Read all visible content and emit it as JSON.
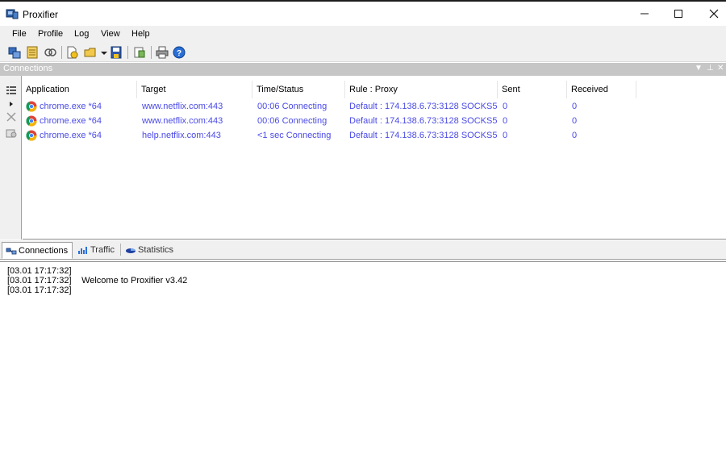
{
  "window": {
    "title": "Proxifier",
    "controls": {
      "minimize": "—",
      "maximize": "☐",
      "close": "✕"
    }
  },
  "menu": [
    "File",
    "Profile",
    "Log",
    "View",
    "Help"
  ],
  "toolbar": {
    "icons": [
      "proxy-servers-icon",
      "proxification-rules-icon",
      "name-resolution-icon",
      "new-profile-icon",
      "open-profile-icon",
      "save-profile-icon",
      "export-icon",
      "print-icon",
      "help-icon"
    ]
  },
  "panel": {
    "title": "Connections",
    "controls": {
      "dropdown": "▼",
      "pin": "⊥",
      "close": "✕"
    }
  },
  "connections": {
    "columns": [
      "Application",
      "Target",
      "Time/Status",
      "Rule : Proxy",
      "Sent",
      "Received"
    ],
    "rows": [
      {
        "application": "chrome.exe *64",
        "target": "www.netflix.com:443",
        "status": "00:06 Connecting",
        "rule_proxy": "Default : 174.138.6.73:3128 SOCKS5",
        "sent": "0",
        "received": "0"
      },
      {
        "application": "chrome.exe *64",
        "target": "www.netflix.com:443",
        "status": "00:06 Connecting",
        "rule_proxy": "Default : 174.138.6.73:3128 SOCKS5",
        "sent": "0",
        "received": "0"
      },
      {
        "application": "chrome.exe *64",
        "target": "help.netflix.com:443",
        "status": "<1 sec Connecting",
        "rule_proxy": "Default : 174.138.6.73:3128 SOCKS5",
        "sent": "0",
        "received": "0"
      }
    ],
    "text_color": "#4a4ae8"
  },
  "tabs": [
    {
      "label": "Connections",
      "icon": "connections-icon",
      "active": true
    },
    {
      "label": "Traffic",
      "icon": "traffic-icon",
      "active": false
    },
    {
      "label": "Statistics",
      "icon": "statistics-icon",
      "active": false
    }
  ],
  "log": [
    {
      "time": "[03.01 17:17:32]",
      "message": ""
    },
    {
      "time": "[03.01 17:17:32]",
      "message": "Welcome to Proxifier v3.42"
    },
    {
      "time": "[03.01 17:17:32]",
      "message": ""
    }
  ]
}
